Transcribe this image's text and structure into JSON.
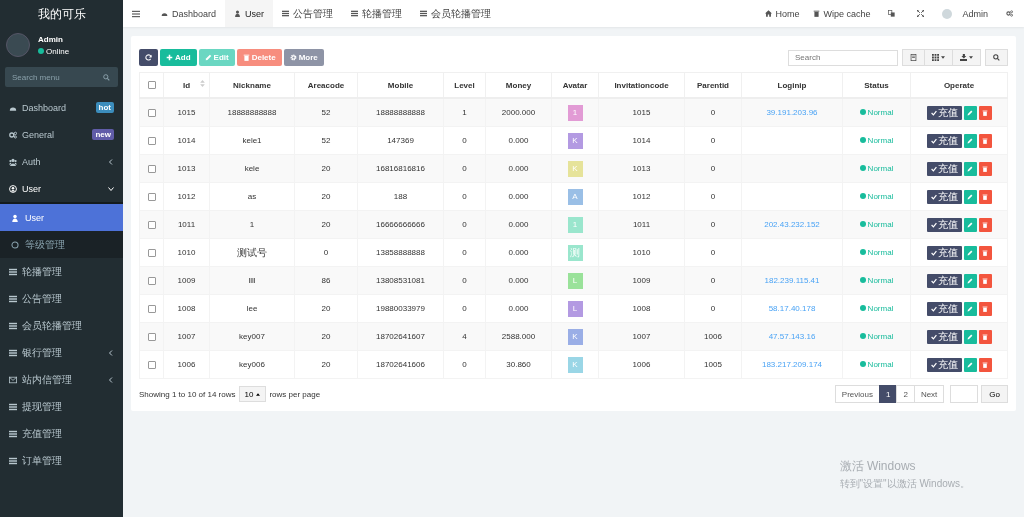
{
  "sidebar": {
    "brand": "我的可乐",
    "user": {
      "name": "Admin",
      "status": "Online"
    },
    "search": {
      "placeholder": "Search menu"
    },
    "items": [
      {
        "kind": "dashboard",
        "label": "Dashboard",
        "badge": {
          "text": "hot",
          "color": "#3c8dbc"
        },
        "selected": false
      },
      {
        "kind": "gears",
        "label": "General",
        "badge": {
          "text": "new",
          "color": "#605ca8"
        },
        "selected": false
      },
      {
        "kind": "users",
        "label": "Auth",
        "expanded": false,
        "selected": false
      },
      {
        "kind": "user-circle",
        "label": "User",
        "expanded": true,
        "selected": false,
        "children": [
          {
            "kind": "user",
            "label": "User",
            "selected": true
          },
          {
            "kind": "circle",
            "label": "等级管理",
            "selected": false
          }
        ]
      },
      {
        "kind": "list",
        "label": "轮播管理",
        "selected": false
      },
      {
        "kind": "list",
        "label": "公告管理",
        "selected": false
      },
      {
        "kind": "list",
        "label": "会员轮播管理",
        "selected": false
      },
      {
        "kind": "list",
        "label": "银行管理",
        "expanded": false,
        "selected": false
      },
      {
        "kind": "envelope",
        "label": "站内信管理",
        "expanded": false,
        "selected": false
      },
      {
        "kind": "list",
        "label": "提现管理",
        "selected": false
      },
      {
        "kind": "list",
        "label": "充值管理",
        "selected": false
      },
      {
        "kind": "list",
        "label": "订单管理",
        "selected": false
      }
    ]
  },
  "tabs": [
    {
      "kind": "dashboard",
      "label": "Dashboard",
      "selected": false
    },
    {
      "kind": "user",
      "label": "User",
      "selected": true
    },
    {
      "kind": "list",
      "label": "公告管理",
      "selected": false
    },
    {
      "kind": "list",
      "label": "轮播管理",
      "selected": false
    },
    {
      "kind": "list",
      "label": "会员轮播管理",
      "selected": false
    }
  ],
  "topbar_right": {
    "home": "Home",
    "wipe_cache": "Wipe cache",
    "user": "Admin"
  },
  "toolbar": {
    "buttons": [
      {
        "kind": "refresh"
      },
      {
        "kind": "add",
        "label": "Add"
      },
      {
        "kind": "edit",
        "label": "Edit"
      },
      {
        "kind": "delete",
        "label": "Delete"
      },
      {
        "kind": "more",
        "label": "More"
      }
    ],
    "search": {
      "placeholder": "Search"
    }
  },
  "table": {
    "all_checked": false,
    "columns": [
      "Id",
      "Nickname",
      "Areacode",
      "Mobile",
      "Level",
      "Money",
      "Avatar",
      "Invitationcode",
      "Parentid",
      "Loginip",
      "Status",
      "Operate"
    ],
    "rows": [
      {
        "checked": false,
        "id": "1015",
        "nickname": "18888888888",
        "areacode": "52",
        "mobile": "18888888888",
        "level": "1",
        "money": "2000.000",
        "avatar": {
          "letter": "1",
          "color": "#e29bd5"
        },
        "invitationcode": "1015",
        "parentid": "0",
        "loginip": "39.191.203.96",
        "status": "Normal",
        "recharge": "充值"
      },
      {
        "checked": false,
        "id": "1014",
        "nickname": "kele1",
        "areacode": "52",
        "mobile": "147369",
        "level": "0",
        "money": "0.000",
        "avatar": {
          "letter": "K",
          "color": "#b39ae2"
        },
        "invitationcode": "1014",
        "parentid": "0",
        "loginip": "",
        "status": "Normal",
        "recharge": "充值"
      },
      {
        "checked": false,
        "id": "1013",
        "nickname": "kele",
        "areacode": "20",
        "mobile": "16816816816",
        "level": "0",
        "money": "0.000",
        "avatar": {
          "letter": "K",
          "color": "#e6e39a"
        },
        "invitationcode": "1013",
        "parentid": "0",
        "loginip": "",
        "status": "Normal",
        "recharge": "充值"
      },
      {
        "checked": false,
        "id": "1012",
        "nickname": "as",
        "areacode": "20",
        "mobile": "188",
        "level": "0",
        "money": "0.000",
        "avatar": {
          "letter": "A",
          "color": "#9abfe6"
        },
        "invitationcode": "1012",
        "parentid": "0",
        "loginip": "",
        "status": "Normal",
        "recharge": "充值"
      },
      {
        "checked": false,
        "id": "1011",
        "nickname": "1",
        "areacode": "20",
        "mobile": "16666666666",
        "level": "0",
        "money": "0.000",
        "avatar": {
          "letter": "1",
          "color": "#9ae6cd"
        },
        "invitationcode": "1011",
        "parentid": "0",
        "loginip": "202.43.232.152",
        "status": "Normal",
        "recharge": "充值"
      },
      {
        "checked": false,
        "id": "1010",
        "nickname": "测试号",
        "areacode": "0",
        "mobile": "13858888888",
        "level": "0",
        "money": "0.000",
        "avatar": {
          "letter": "测",
          "color": "#9ae6cd"
        },
        "invitationcode": "1010",
        "parentid": "0",
        "loginip": "",
        "status": "Normal",
        "recharge": "充值"
      },
      {
        "checked": false,
        "id": "1009",
        "nickname": "llll",
        "areacode": "86",
        "mobile": "13808531081",
        "level": "0",
        "money": "0.000",
        "avatar": {
          "letter": "L",
          "color": "#9ae29a"
        },
        "invitationcode": "1009",
        "parentid": "0",
        "loginip": "182.239.115.41",
        "status": "Normal",
        "recharge": "充值"
      },
      {
        "checked": false,
        "id": "1008",
        "nickname": "lee",
        "areacode": "20",
        "mobile": "19880033979",
        "level": "0",
        "money": "0.000",
        "avatar": {
          "letter": "L",
          "color": "#b39ae2"
        },
        "invitationcode": "1008",
        "parentid": "0",
        "loginip": "58.17.40.178",
        "status": "Normal",
        "recharge": "充值"
      },
      {
        "checked": false,
        "id": "1007",
        "nickname": "key007",
        "areacode": "20",
        "mobile": "18702641607",
        "level": "4",
        "money": "2588.000",
        "avatar": {
          "letter": "K",
          "color": "#9aaee6"
        },
        "invitationcode": "1007",
        "parentid": "1006",
        "loginip": "47.57.143.16",
        "status": "Normal",
        "recharge": "充值"
      },
      {
        "checked": false,
        "id": "1006",
        "nickname": "key006",
        "areacode": "20",
        "mobile": "18702641606",
        "level": "0",
        "money": "30.860",
        "avatar": {
          "letter": "K",
          "color": "#9ad6e6"
        },
        "invitationcode": "1006",
        "parentid": "1005",
        "loginip": "183.217.209.174",
        "status": "Normal",
        "recharge": "充值"
      }
    ]
  },
  "footer": {
    "summary": "Showing 1 to 10 of 14 rows",
    "page_size": "10",
    "page_size_suffix": "rows per page",
    "pages": [
      {
        "label": "Previous",
        "selected": false
      },
      {
        "label": "1",
        "selected": true
      },
      {
        "label": "2",
        "selected": false
      },
      {
        "label": "Next",
        "selected": false
      }
    ],
    "go": "Go"
  },
  "windows_notice": {
    "title": "激活 Windows",
    "text": "转到\"设置\"以激活 Windows。"
  }
}
